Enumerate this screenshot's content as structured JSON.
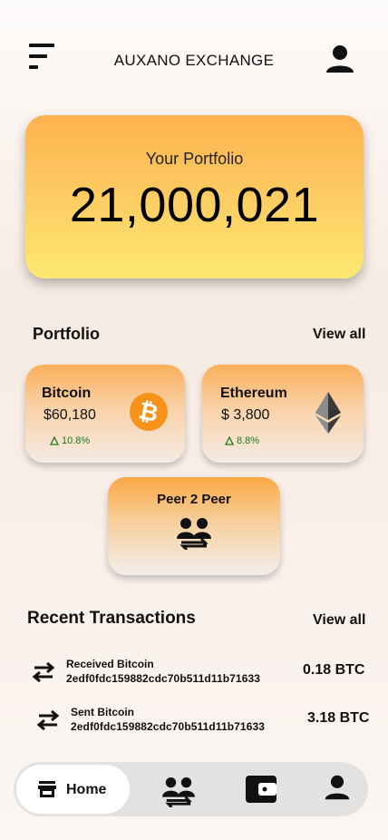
{
  "header": {
    "title": "AUXANO EXCHANGE"
  },
  "portfolio_card": {
    "label": "Your Portfolio",
    "value": "21,000,021"
  },
  "portfolio_section": {
    "title": "Portfolio",
    "view_all": "View all",
    "coins": [
      {
        "name": "Bitcoin",
        "price": "$60,180",
        "change": "10.8%",
        "icon": "bitcoin-icon",
        "color": "#f7931a"
      },
      {
        "name": "Ethereum",
        "price": "$ 3,800",
        "change": "8.8%",
        "icon": "ethereum-icon",
        "color": "#3c3c3d"
      }
    ],
    "p2p": {
      "label": "Peer 2 Peer",
      "icon": "peer-exchange-icon"
    }
  },
  "transactions": {
    "title": "Recent Transactions",
    "view_all": "View all",
    "items": [
      {
        "title": "Received Bitcoin",
        "hash": "2edf0fdc159882cdc70b511d11b71633",
        "amount": "0.18 BTC",
        "icon": "swap-arrows-icon"
      },
      {
        "title": "Sent Bitcoin",
        "hash": "2edf0fdc159882cdc70b511d11b71633",
        "amount": "3.18 BTC",
        "icon": "swap-arrows-icon"
      }
    ]
  },
  "bottom_nav": {
    "home_label": "Home",
    "items": [
      "store-icon",
      "peer-exchange-icon",
      "wallet-icon",
      "person-icon"
    ]
  },
  "colors": {
    "accent_orange": "#fdb24f",
    "accent_yellow": "#fde873",
    "positive": "#1b7a1b"
  }
}
